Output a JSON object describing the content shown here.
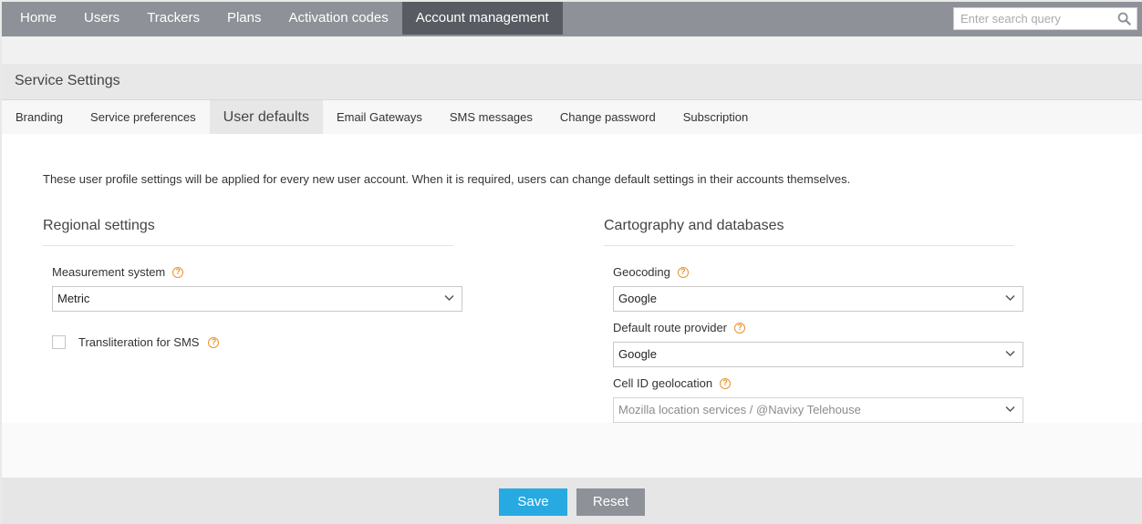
{
  "nav": {
    "items": [
      {
        "label": "Home"
      },
      {
        "label": "Users"
      },
      {
        "label": "Trackers"
      },
      {
        "label": "Plans"
      },
      {
        "label": "Activation codes"
      },
      {
        "label": "Account management",
        "active": true
      }
    ],
    "search_placeholder": "Enter search query"
  },
  "panel": {
    "title": "Service Settings",
    "tabs": [
      {
        "label": "Branding"
      },
      {
        "label": "Service preferences"
      },
      {
        "label": "User defaults",
        "active": true
      },
      {
        "label": "Email Gateways"
      },
      {
        "label": "SMS messages"
      },
      {
        "label": "Change password"
      },
      {
        "label": "Subscription"
      }
    ]
  },
  "content": {
    "intro": "These user profile settings will be applied for every new user account. When it is required, users can change default settings in their accounts themselves.",
    "regional": {
      "title": "Regional settings",
      "measurement_label": "Measurement system",
      "measurement_value": "Metric",
      "transliteration_label": "Transliteration for SMS",
      "transliteration_checked": false
    },
    "carto": {
      "title": "Cartography and databases",
      "geocoding_label": "Geocoding",
      "geocoding_value": "Google",
      "route_label": "Default route provider",
      "route_value": "Google",
      "cellid_label": "Cell ID geolocation",
      "cellid_value": "Mozilla location services / @Navixy Telehouse"
    }
  },
  "footer": {
    "save_label": "Save",
    "reset_label": "Reset"
  },
  "colors": {
    "nav_bg": "#8e9197",
    "nav_active": "#585b62",
    "save": "#27a9e1",
    "reset": "#8e9197",
    "help_icon": "#e8932f"
  }
}
